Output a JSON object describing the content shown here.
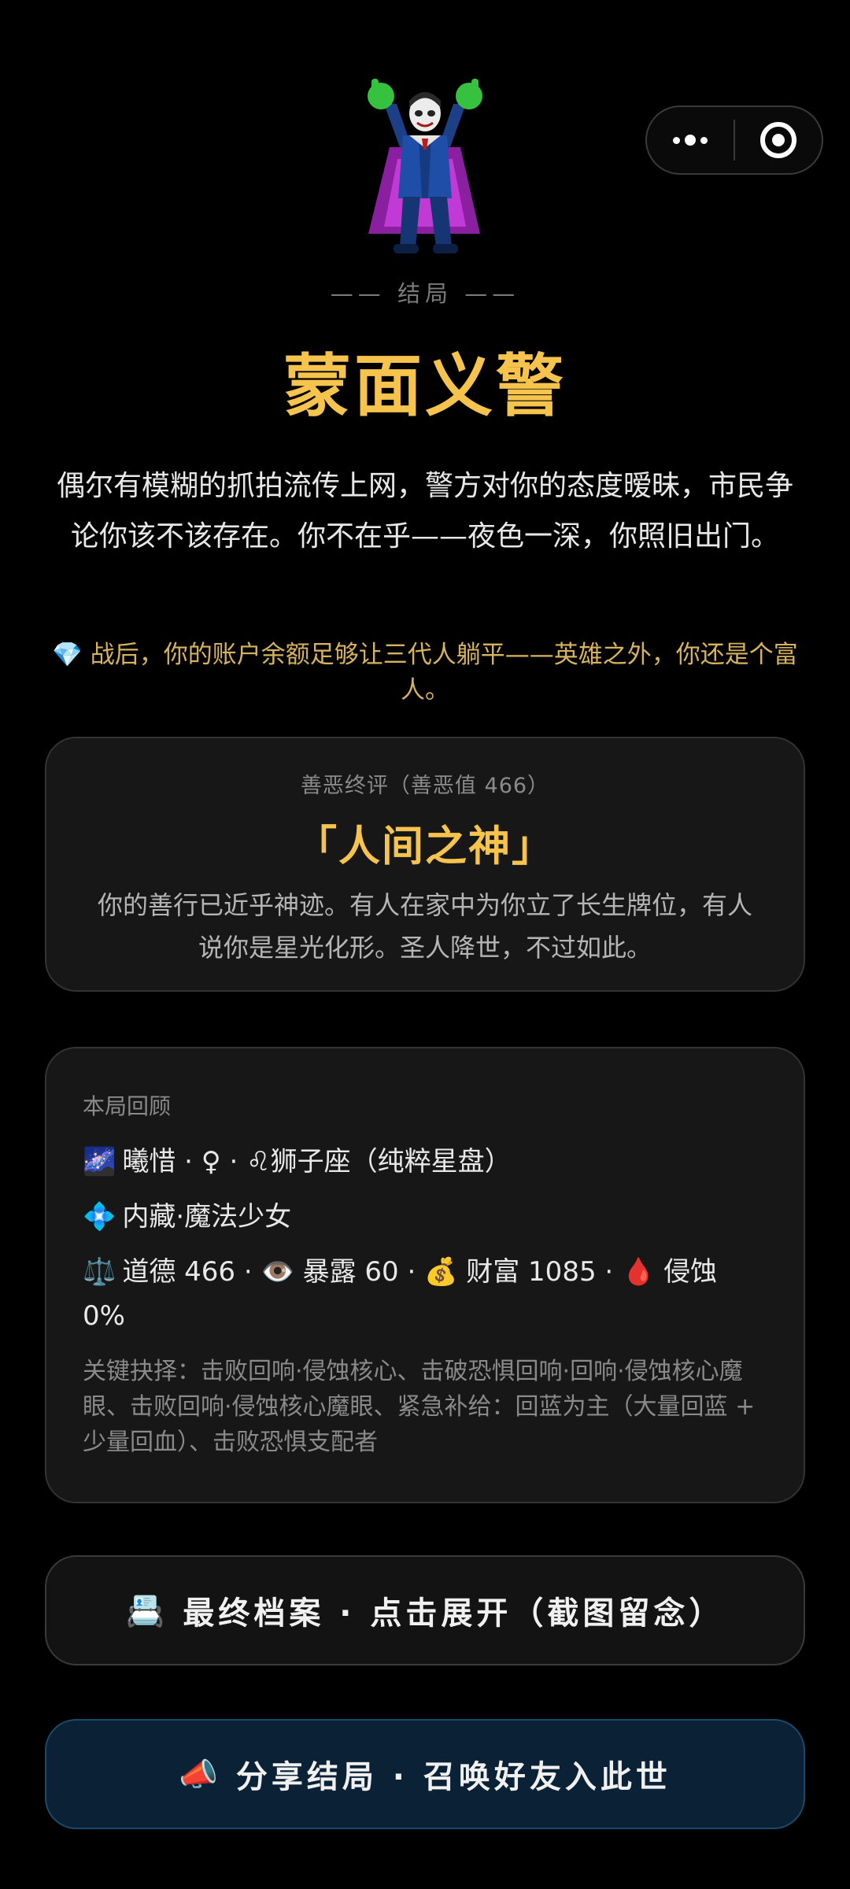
{
  "hero": {
    "icon_name": "supervillain-icon"
  },
  "ending": {
    "label": "—— 结局 ——",
    "title": "蒙面义警",
    "description": "偶尔有模糊的抓拍流传上网，警方对你的态度暧昧，市民争论你该不该存在。你不在乎——夜色一深，你照旧出门。",
    "wealth_icon": "💎",
    "wealth_note": "战后，你的账户余额足够让三代人躺平——英雄之外，你还是个富人。"
  },
  "verdict": {
    "label": "善恶终评（善恶值 466）",
    "title": "「人间之神」",
    "description": "你的善行已近乎神迹。有人在家中为你立了长生牌位，有人说你是星光化形。圣人降世，不过如此。"
  },
  "review": {
    "label": "本局回顾",
    "profile_icon": "🌌",
    "profile": "曦惜 · ♀ · ♌狮子座（纯粹星盘）",
    "class_icon": "💠",
    "class": "内藏·魔法少女",
    "stats_icon": "⚖️",
    "stats": "道德 466 · 👁️ 暴露 60 · 💰 财富 1085 · 🩸 侵蚀 0%",
    "choices": "关键抉择：击败回响·侵蚀核心、击破恐惧回响·回响·侵蚀核心魔眼、击败回响·侵蚀核心魔眼、紧急补给：回蓝为主（大量回蓝 + 少量回血）、击败恐惧支配者"
  },
  "buttons": {
    "archive_icon": "📇",
    "archive_label": "最终档案 · 点击展开（截图留念）",
    "share_icon": "📣",
    "share_label": "分享结局 · 召唤好友入此世"
  },
  "colors": {
    "background": "#000000",
    "accent_gold": "#f6c34c",
    "card_bg": "#171717",
    "share_bg": "#0b2236",
    "share_border": "#1c4a6d"
  }
}
